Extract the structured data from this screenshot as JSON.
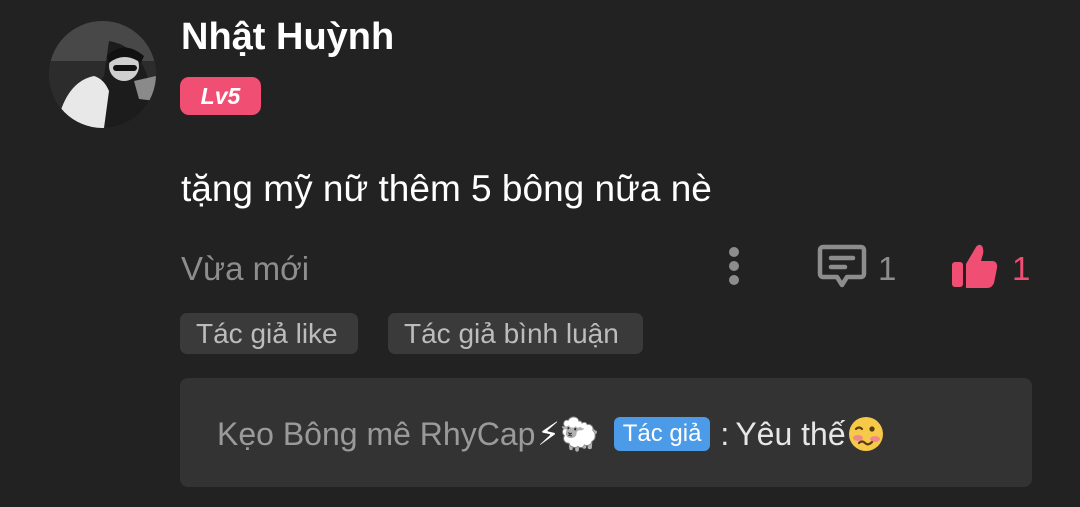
{
  "comment": {
    "user": {
      "name": "Nhật Huỳnh",
      "level": "Lv5"
    },
    "text": "tặng mỹ nữ thêm 5 bông nữa nè",
    "timestamp": "Vừa mới",
    "reply_count": "1",
    "like_count": "1",
    "liked": true,
    "tags": [
      "Tác giả like",
      "Tác giả bình luận"
    ]
  },
  "reply": {
    "author": "Kẹo Bông mê RhyCap",
    "author_emoji": "⚡🐑",
    "badge": "Tác giả",
    "separator": ":",
    "message": "Yêu thế",
    "message_emoji": "woozy-face"
  },
  "colors": {
    "background": "#222222",
    "accent_pink": "#f14e74",
    "badge_blue": "#4c9be8",
    "muted_text": "#8d8d8d",
    "tag_bg": "#3a3a3a",
    "reply_bg": "#333333"
  },
  "icons": {
    "more": "more-vertical-icon",
    "reply": "comment-bubble-icon",
    "like": "thumbs-up-icon"
  }
}
